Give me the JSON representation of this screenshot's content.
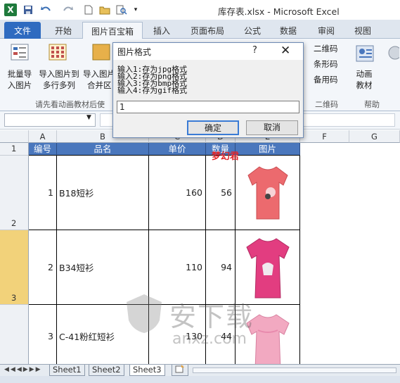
{
  "window": {
    "title": "库存表.xlsx - Microsoft Excel"
  },
  "ribbon_tabs": [
    "文件",
    "开始",
    "图片百宝箱",
    "插入",
    "页面布局",
    "公式",
    "数据",
    "审阅",
    "视图"
  ],
  "ribbon": {
    "btn1": [
      "批量导",
      "入图片"
    ],
    "btn2": [
      "导入图片到",
      "多行多列"
    ],
    "btn3": [
      "导入图片",
      "合并区"
    ],
    "group_label": "请先看动画教材后使",
    "qr": [
      "二维码",
      "条形码",
      "备用码"
    ],
    "qr_group_label": "二维码",
    "anim": [
      "动画",
      "教材"
    ],
    "help_label": "帮助"
  },
  "formula_bar": {
    "namebox_value": ""
  },
  "columns": [
    "A",
    "B",
    "C",
    "D",
    "E",
    "F",
    "G"
  ],
  "rows": [
    "1",
    "2",
    "3"
  ],
  "table": {
    "headers": [
      "编号",
      "品名",
      "单价",
      "数量",
      "图片"
    ],
    "rows": [
      {
        "id": "1",
        "name": "B18短衫",
        "price": "160",
        "qty": "56"
      },
      {
        "id": "2",
        "name": "B34短衫",
        "price": "110",
        "qty": "94"
      },
      {
        "id": "3",
        "name": "C-41粉红短衫",
        "price": "130",
        "qty": "44"
      }
    ]
  },
  "overlay_text": "梦幻君",
  "watermark": {
    "brand": "安下载",
    "url": "anxz.com"
  },
  "sheets": [
    "Sheet1",
    "Sheet2",
    "Sheet3"
  ],
  "active_sheet": "Sheet3",
  "dialog": {
    "title": "图片格式",
    "lines": [
      "输入1:存为jpg格式",
      "输入2:存为png格式",
      "输入3:存为bmp格式",
      "输入4:存为gif格式"
    ],
    "input_value": "1",
    "ok_label": "确定",
    "cancel_label": "取消",
    "help_glyph": "?",
    "close_glyph": "✕"
  }
}
